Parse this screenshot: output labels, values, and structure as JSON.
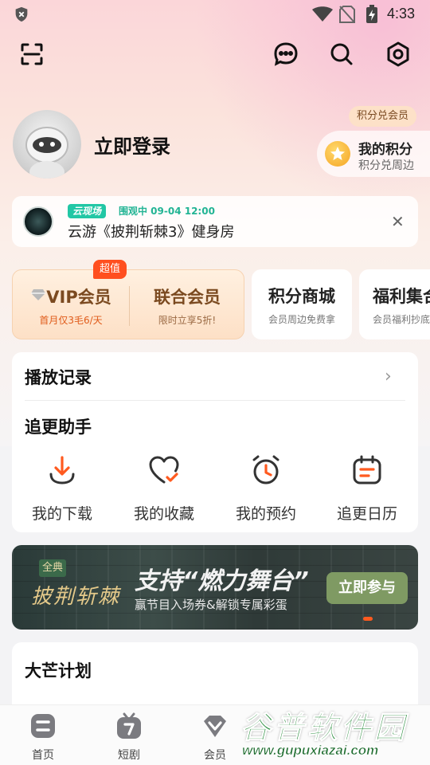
{
  "status_bar": {
    "time": "4:33"
  },
  "top_bar": {
    "icons": [
      "scan-icon",
      "message-icon",
      "search-icon",
      "settings-icon"
    ]
  },
  "profile": {
    "login_label": "立即登录",
    "points_tag": "积分兑会员",
    "points_title": "我的积分",
    "points_sub": "积分兑周边"
  },
  "live_banner": {
    "badge": "云现场",
    "meta": "围观中 09-04 12:00",
    "title": "云游《披荆斩棘3》健身房"
  },
  "membership": {
    "tag": "超值",
    "vip": {
      "title": "VIP会员",
      "sub": "首月仅3毛6/天"
    },
    "union": {
      "title": "联合会员",
      "sub": "限时立享5折!"
    },
    "mall": {
      "title": "积分商城",
      "sub": "会员周边免费拿"
    },
    "welfare": {
      "title": "福利集合",
      "sub": "会员福利抄底"
    }
  },
  "history": {
    "label": "播放记录"
  },
  "tracker": {
    "title": "追更助手",
    "tools": [
      {
        "label": "我的下载",
        "icon": "download-icon"
      },
      {
        "label": "我的收藏",
        "icon": "favorite-icon"
      },
      {
        "label": "我的预约",
        "icon": "alarm-icon"
      },
      {
        "label": "追更日历",
        "icon": "calendar-icon"
      }
    ]
  },
  "promo": {
    "logo_tag": "全典",
    "logo": "披荆斩棘",
    "headline": "支持“燃力舞台”",
    "sub": "赢节目入场券&解锁专属彩蛋",
    "button": "立即参与"
  },
  "plan": {
    "title": "大芒计划"
  },
  "bottom_nav": [
    {
      "label": "首页",
      "icon": "home-icon"
    },
    {
      "label": "短剧",
      "icon": "tv-icon"
    },
    {
      "label": "会员",
      "icon": "vip-icon"
    }
  ],
  "watermark": {
    "text": "谷普软件园",
    "url": "www.gupuxiazai.com"
  },
  "colors": {
    "accent": "#ff5a1f",
    "live_green": "#22c7a5",
    "vip_brown": "#7b4a20"
  }
}
